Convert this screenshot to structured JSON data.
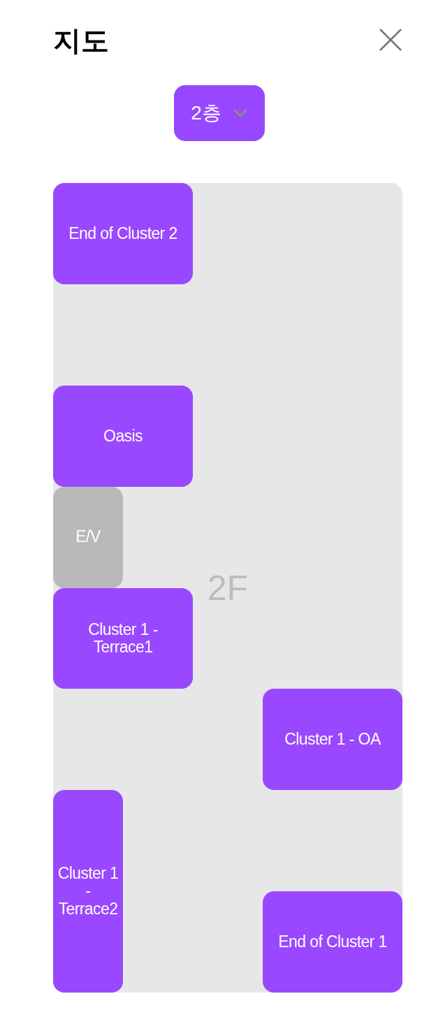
{
  "title": "지도",
  "floor_selector": {
    "label": "2층"
  },
  "map": {
    "floor_label": "2F",
    "rooms": [
      {
        "name": "End of Cluster 2",
        "kind": "room"
      },
      {
        "name": "Oasis",
        "kind": "room"
      },
      {
        "name": "E/V",
        "kind": "elevator"
      },
      {
        "name": "Cluster 1 - Terrace1",
        "kind": "room"
      },
      {
        "name": "Cluster 1 - OA",
        "kind": "room"
      },
      {
        "name": "Cluster 1 - Terrace2",
        "kind": "room"
      },
      {
        "name": "End of Cluster 1",
        "kind": "room"
      }
    ]
  }
}
